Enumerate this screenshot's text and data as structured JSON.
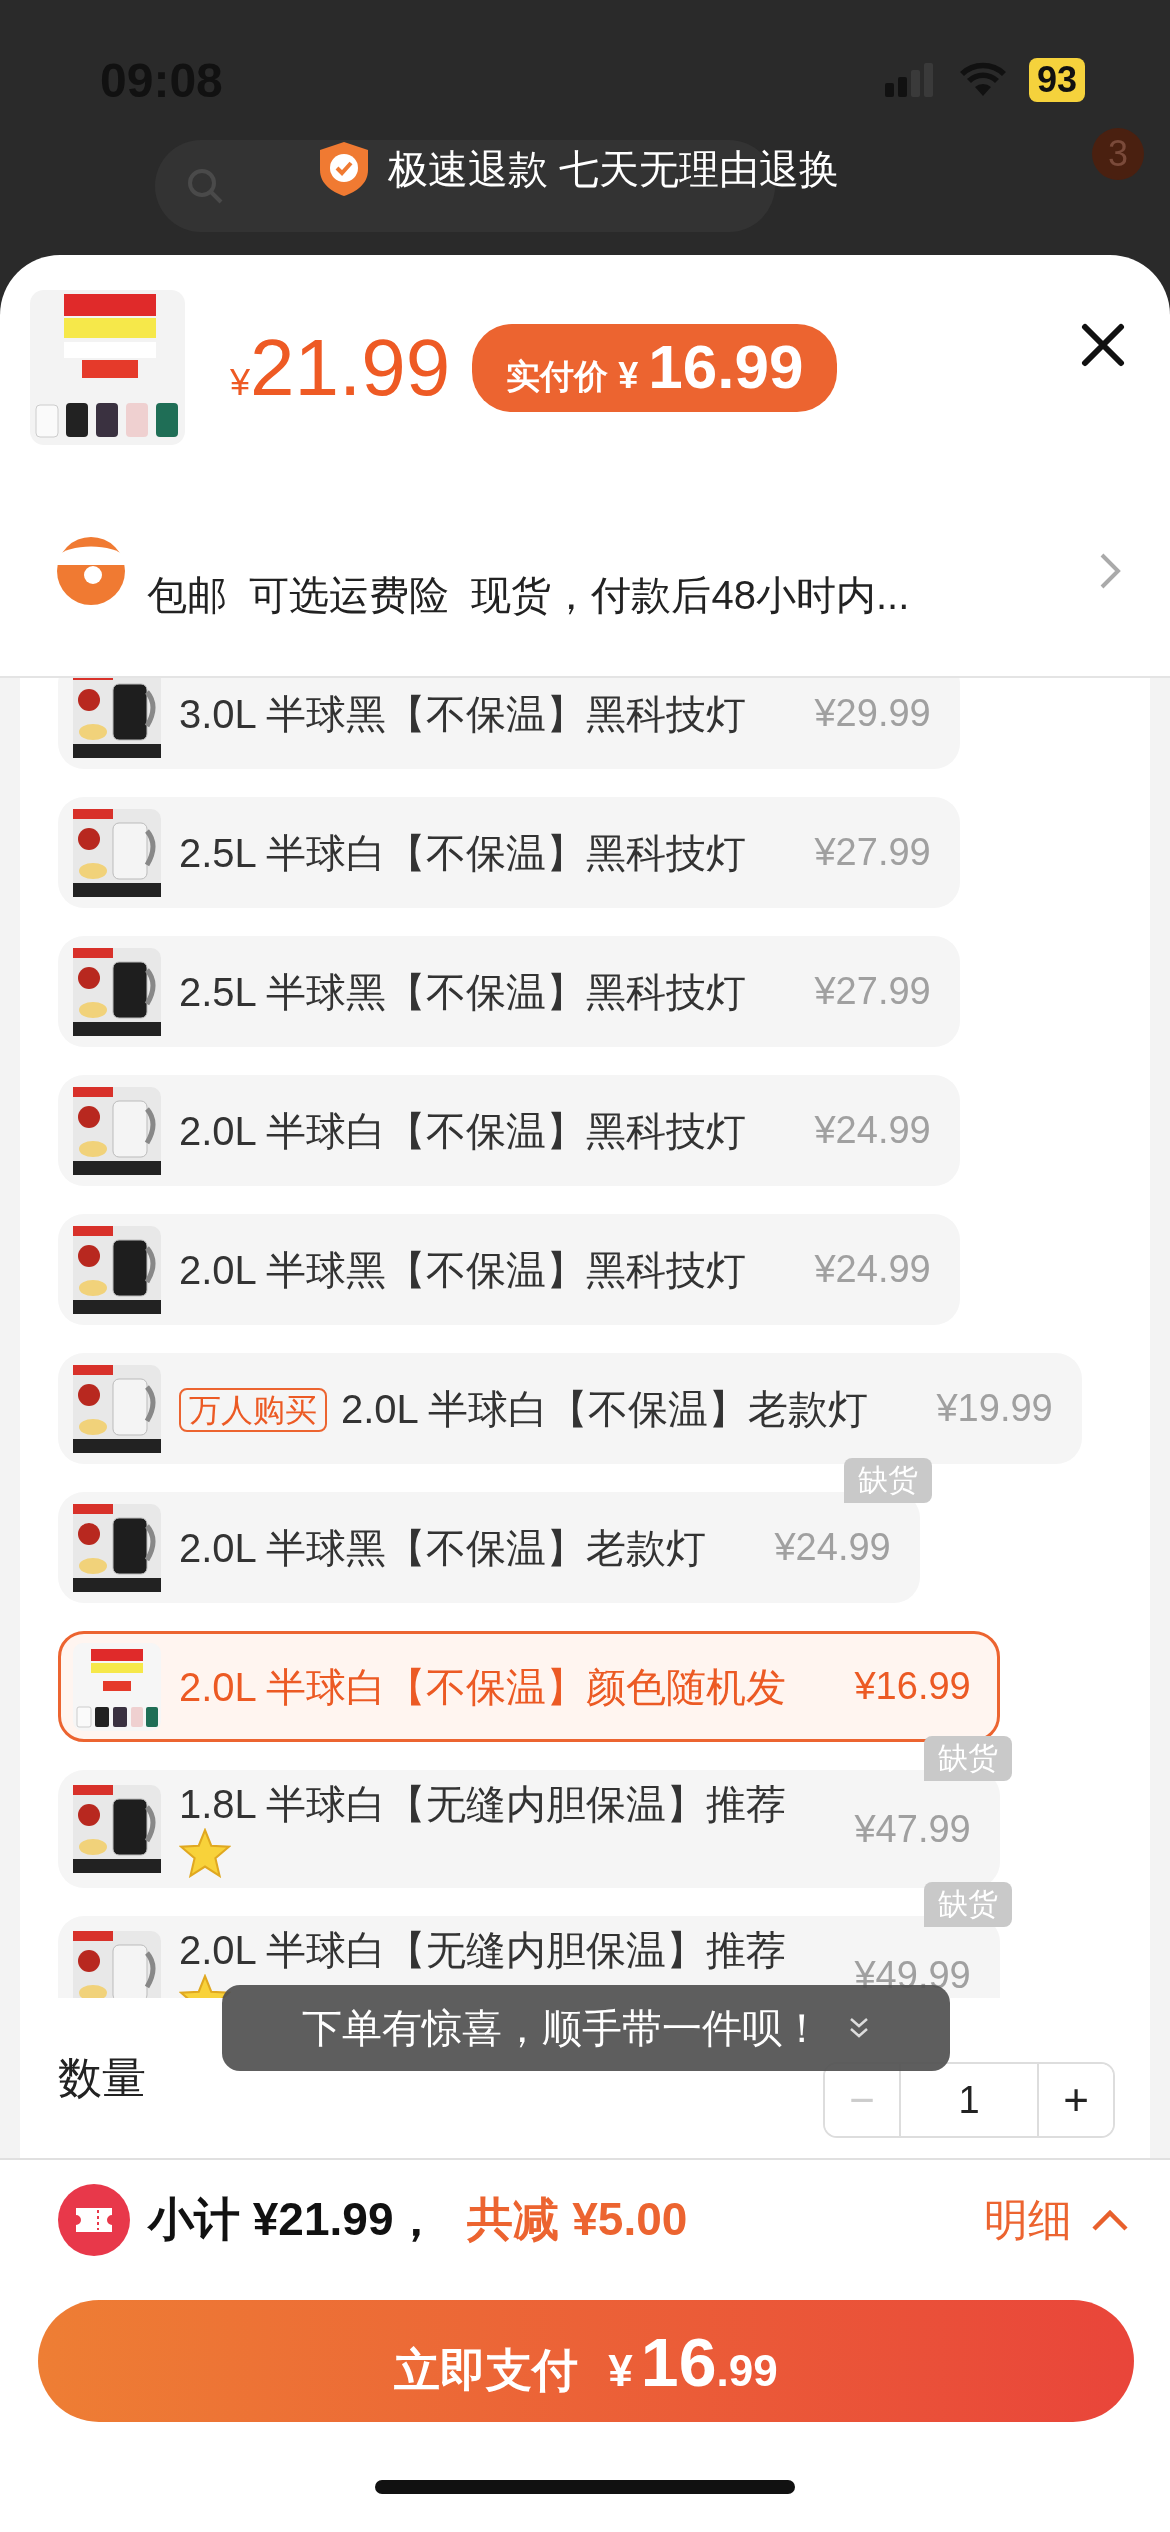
{
  "status_bar": {
    "time": "09:08",
    "battery": "93"
  },
  "background": {
    "cart_count": "3"
  },
  "banner": {
    "text": "极速退款 七天无理由退换"
  },
  "header": {
    "price_symbol": "¥",
    "price": "21.99",
    "paid_label": "实付价",
    "paid_symbol": "¥",
    "paid_price": "16.99"
  },
  "shipping": {
    "text": "包邮  可选运费险  现货，付款后48小时内..."
  },
  "options": [
    {
      "name": "3.0L 半球黑【不保温】黑科技灯",
      "price": "¥29.99",
      "selected": false
    },
    {
      "name": "2.5L 半球白【不保温】黑科技灯",
      "price": "¥27.99",
      "selected": false
    },
    {
      "name": "2.5L 半球黑【不保温】黑科技灯",
      "price": "¥27.99",
      "selected": false
    },
    {
      "name": "2.0L 半球白【不保温】黑科技灯",
      "price": "¥24.99",
      "selected": false
    },
    {
      "name": "2.0L 半球黑【不保温】黑科技灯",
      "price": "¥24.99",
      "selected": false
    },
    {
      "tag": "万人购买",
      "name": "2.0L 半球白【不保温】老款灯",
      "price": "¥19.99",
      "selected": false
    },
    {
      "badge": "缺货",
      "name": "2.0L 半球黑【不保温】老款灯",
      "price": "¥24.99",
      "selected": false
    },
    {
      "name": "2.0L 半球白【不保温】颜色随机发",
      "price": "¥16.99",
      "selected": true
    },
    {
      "badge": "缺货",
      "name": "1.8L 半球白【无缝内胆保温】推荐",
      "star": true,
      "price": "¥47.99",
      "selected": false
    },
    {
      "badge": "缺货",
      "name": "2.0L 半球白【无缝内胆保温】推荐",
      "star": true,
      "price": "¥49.99",
      "selected": false
    }
  ],
  "toast": {
    "text": "下单有惊喜，顺手带一件呗！"
  },
  "quantity": {
    "label": "数量",
    "minus": "−",
    "value": "1",
    "plus": "+",
    "minus_disabled": true
  },
  "footer": {
    "subtotal": "小计 ¥21.99，",
    "discount": "共减 ¥5.00",
    "details": "明细"
  },
  "pay_button": {
    "label": "立即支付",
    "symbol": "¥",
    "integer": "16",
    "decimal": ".99"
  }
}
